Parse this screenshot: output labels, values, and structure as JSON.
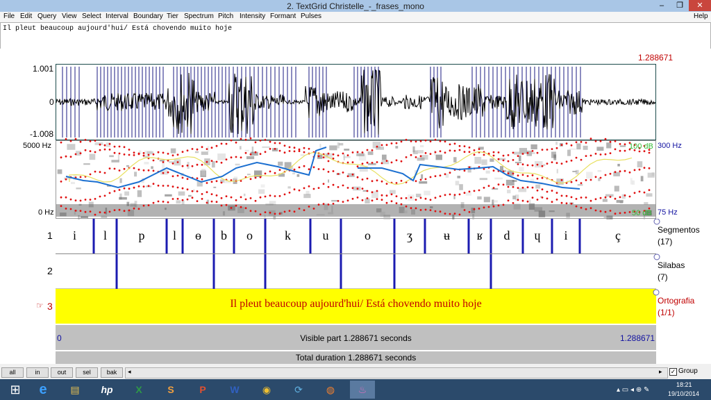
{
  "window": {
    "title": "2. TextGrid Christelle_-_frases_mono",
    "min_label": "–",
    "restore_label": "❐",
    "close_label": "✕"
  },
  "menu": [
    "File",
    "Edit",
    "Query",
    "View",
    "Select",
    "Interval",
    "Boundary",
    "Tier",
    "Spectrum",
    "Pitch",
    "Intensity",
    "Formant",
    "Pulses"
  ],
  "menu_help": "Help",
  "text_field": "Il pleut beaucoup aujourd'hui/ Está chovendo muito hoje",
  "top_time": "1.288671",
  "waveform": {
    "ymax": "1.001",
    "ymid": "0",
    "ymin": "-1.008"
  },
  "spectrogram": {
    "top_freq": "5000 Hz",
    "bottom_freq": "0 Hz",
    "pitch_top": "300 Hz",
    "pitch_bottom": "75 Hz",
    "int_top": "100 dB",
    "int_bottom": "50 dB"
  },
  "tiers": [
    {
      "number": "1",
      "name": "Segmentos",
      "count": "(17)"
    },
    {
      "number": "2",
      "name": "Silabas",
      "count": "(7)"
    },
    {
      "number": "3",
      "name": "Ortografia",
      "count": "(1/1)"
    }
  ],
  "segments": [
    "i",
    "l",
    "p",
    "l",
    "ɵ",
    "b",
    "o",
    "k",
    "u",
    "o",
    "ʒ",
    "ʉ",
    "ʁ",
    "d",
    "ɥ",
    "i",
    "ç"
  ],
  "ortho_text": "Il pleut beaucoup aujourd'hui/ Está chovendo muito hoje",
  "visible_start": "0",
  "visible_label": "Visible part 1.288671 seconds",
  "visible_end": "1.288671",
  "total_label": "Total duration 1.288671 seconds",
  "buttons": [
    "all",
    "in",
    "out",
    "sel",
    "bak"
  ],
  "group_label": "Group",
  "taskbar": {
    "time": "18:21",
    "date": "19/10/2014"
  }
}
